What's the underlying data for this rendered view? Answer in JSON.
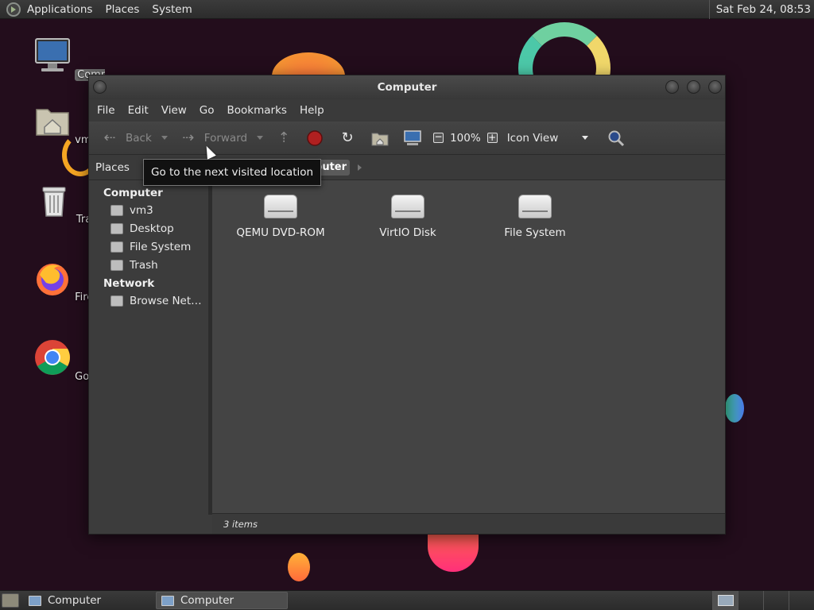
{
  "top_panel": {
    "menus": [
      "Applications",
      "Places",
      "System"
    ],
    "clock": "Sat Feb 24, 08:53"
  },
  "desktop_icons": {
    "computer": "Computer",
    "home": "vm3's Home",
    "trash": "Trash",
    "firefox": "Firefox",
    "chrome": "Google Chrome"
  },
  "window": {
    "title": "Computer",
    "menubar": [
      "File",
      "Edit",
      "View",
      "Go",
      "Bookmarks",
      "Help"
    ],
    "toolbar": {
      "back": "Back",
      "forward": "Forward",
      "zoom": "100%",
      "view_mode": "Icon View"
    },
    "location": {
      "places_label": "Places",
      "breadcrumb": "Computer"
    },
    "sidebar": {
      "sections": [
        {
          "heading": "Computer",
          "items": [
            "vm3",
            "Desktop",
            "File System",
            "Trash"
          ]
        },
        {
          "heading": "Network",
          "items": [
            "Browse Net…"
          ]
        }
      ]
    },
    "files": [
      "QEMU DVD-ROM",
      "VirtIO Disk",
      "File System"
    ],
    "status": "3 items",
    "tooltip": "Go to the next visited location"
  },
  "taskbar": {
    "tasks": [
      "Computer",
      "Computer"
    ]
  },
  "colors": {
    "desktop_bg": "#230d1c",
    "window_bg": "#3c3c3c",
    "iconview_bg": "#444444",
    "stop_red": "#b02020"
  }
}
